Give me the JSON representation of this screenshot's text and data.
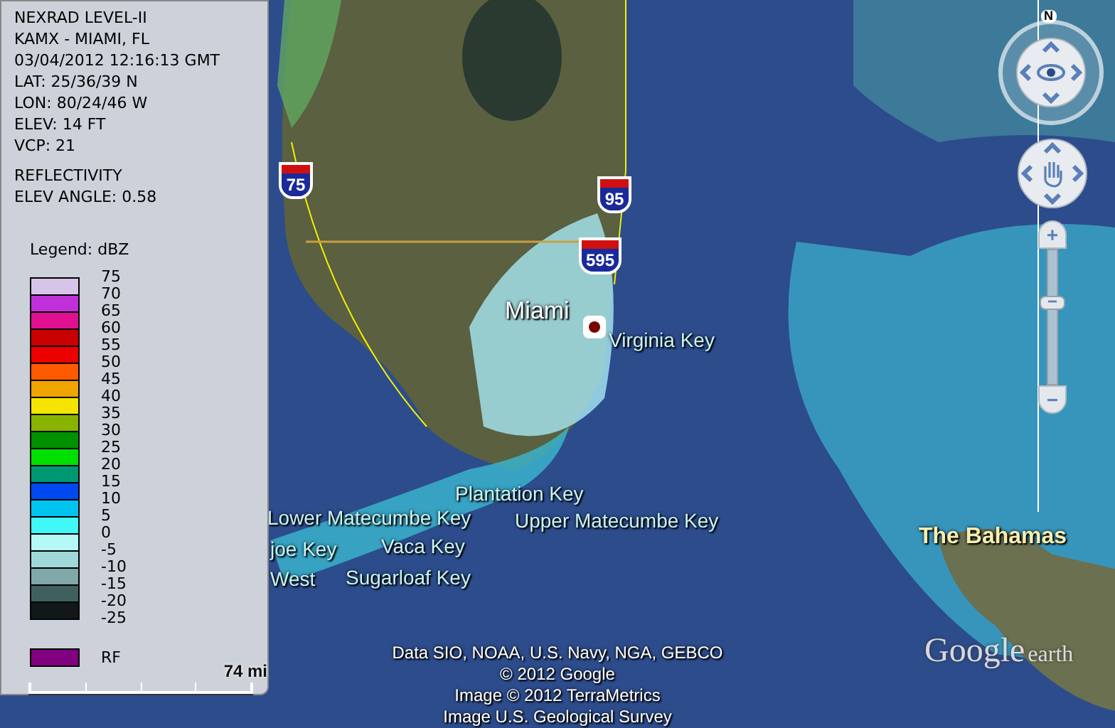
{
  "info_panel": {
    "lines": [
      "NEXRAD LEVEL-II",
      "KAMX - MIAMI, FL",
      "03/04/2012 12:16:13 GMT",
      "LAT: 25/36/39 N",
      "LON: 80/24/46 W",
      "ELEV: 14 FT",
      "VCP: 21"
    ],
    "product_lines": [
      "REFLECTIVITY",
      "ELEV ANGLE: 0.58"
    ],
    "legend": {
      "title": "Legend: dBZ",
      "bands": [
        {
          "color": "#d8c4e8"
        },
        {
          "color": "#c030d8"
        },
        {
          "color": "#e01090"
        },
        {
          "color": "#c80000"
        },
        {
          "color": "#ec0000"
        },
        {
          "color": "#ff5a00"
        },
        {
          "color": "#f0a400"
        },
        {
          "color": "#f4e400"
        },
        {
          "color": "#88b400"
        },
        {
          "color": "#009000"
        },
        {
          "color": "#00e000"
        },
        {
          "color": "#009870"
        },
        {
          "color": "#0048f0"
        },
        {
          "color": "#00c4f0"
        },
        {
          "color": "#40f8f8"
        },
        {
          "color": "#b4f8f8"
        },
        {
          "color": "#a0d8d8"
        },
        {
          "color": "#80a8a8"
        },
        {
          "color": "#406060"
        },
        {
          "color": "#101818"
        }
      ],
      "ticks": [
        "75",
        "70",
        "65",
        "60",
        "55",
        "50",
        "45",
        "40",
        "35",
        "30",
        "25",
        "20",
        "15",
        "10",
        "5",
        "0",
        "-5",
        "-10",
        "-15",
        "-20",
        "-25"
      ],
      "rf": {
        "color": "#800080",
        "label": "RF"
      }
    },
    "scale": "74 mi"
  },
  "map": {
    "shields": [
      {
        "number": "75"
      },
      {
        "number": "95"
      },
      {
        "number": "595"
      }
    ],
    "places": [
      {
        "name": "Miami",
        "kind": "city"
      },
      {
        "name": "Virginia Key",
        "kind": "key"
      },
      {
        "name": "Plantation Key",
        "kind": "key"
      },
      {
        "name": "Lower Matecumbe Key",
        "kind": "key"
      },
      {
        "name": "Upper Matecumbe Key",
        "kind": "key"
      },
      {
        "name": "joe Key",
        "kind": "key"
      },
      {
        "name": "Vaca Key",
        "kind": "key"
      },
      {
        "name": "West",
        "kind": "key"
      },
      {
        "name": "Sugarloaf Key",
        "kind": "key"
      },
      {
        "name": "The Bahamas",
        "kind": "country"
      }
    ],
    "attribution": [
      "Data SIO, NOAA, U.S. Navy, NGA, GEBCO",
      "© 2012 Google",
      "Image © 2012 TerraMetrics",
      "Image U.S. Geological Survey"
    ],
    "logo": {
      "word": "Google",
      "product": "earth"
    }
  },
  "navigation": {
    "north": "N",
    "zoom_in": "+",
    "zoom_out": "−",
    "zoom_thumb": "−",
    "level": 0.62
  }
}
